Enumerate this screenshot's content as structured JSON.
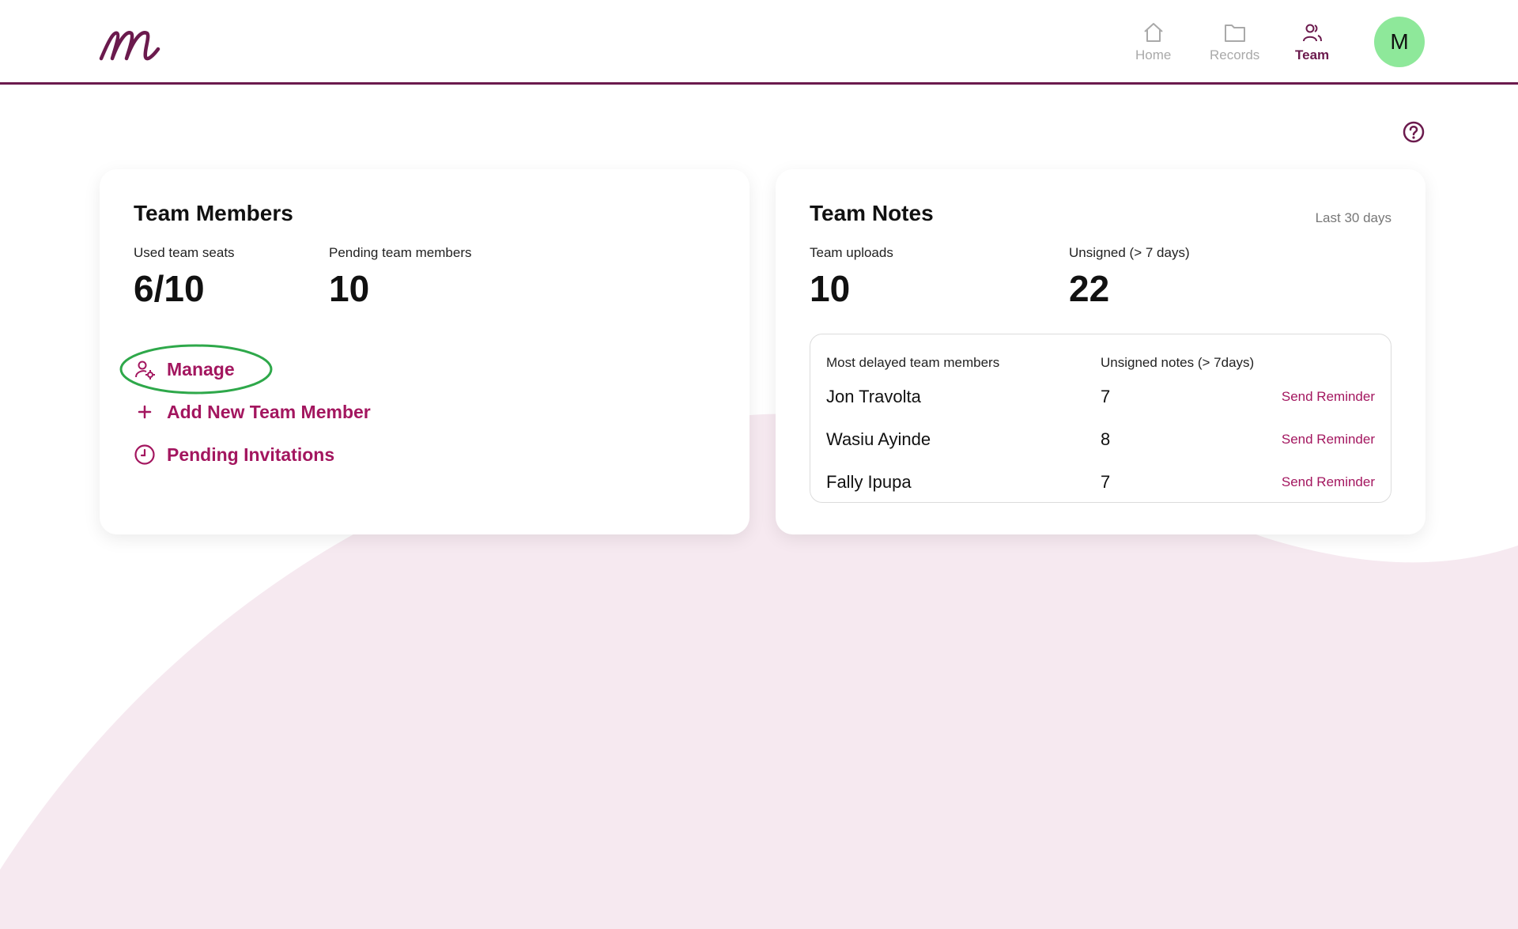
{
  "nav": {
    "home_label": "Home",
    "records_label": "Records",
    "team_label": "Team",
    "avatar_initial": "M"
  },
  "team_members": {
    "title": "Team Members",
    "used_seats_label": "Used team seats",
    "used_seats_value": "6/10",
    "pending_label": "Pending team members",
    "pending_value": "10",
    "actions": {
      "manage": "Manage",
      "add": "Add New Team Member",
      "pending_invitations": "Pending Invitations"
    }
  },
  "team_notes": {
    "title": "Team Notes",
    "range": "Last 30 days",
    "uploads_label": "Team uploads",
    "uploads_value": "10",
    "unsigned_label": "Unsigned (> 7 days)",
    "unsigned_value": "22",
    "table": {
      "col1": "Most delayed team members",
      "col2": "Unsigned notes (> 7days)",
      "rows": [
        {
          "name": "Jon Travolta",
          "count": "7",
          "action": "Send Reminder"
        },
        {
          "name": "Wasiu Ayinde",
          "count": "8",
          "action": "Send Reminder"
        },
        {
          "name": "Fally Ipupa",
          "count": "7",
          "action": "Send Reminder"
        }
      ]
    }
  },
  "colors": {
    "brand": "#6b1a4d",
    "accent": "#a3165f",
    "avatar_bg": "#8ee89a",
    "highlight": "#2ea84a",
    "background_wave": "#f6e9f0"
  }
}
